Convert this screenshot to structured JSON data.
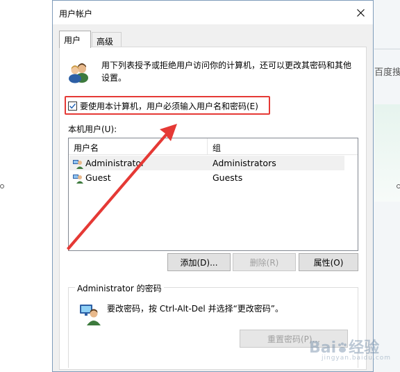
{
  "window": {
    "title": "用户帐户"
  },
  "tabs": [
    {
      "label": "用户",
      "active": true
    },
    {
      "label": "高级",
      "active": false
    }
  ],
  "intro": {
    "text": "用下列表授予或拒绝用户访问你的计算机，还可以更改其密码和其他设置。"
  },
  "require_login": {
    "label": "要使用本计算机，用户必须输入用户名和密码(E)",
    "checked": true
  },
  "local_users": {
    "label": "本机用户(U):",
    "columns": [
      "用户名",
      "组"
    ],
    "rows": [
      {
        "name": "Administrator",
        "group": "Administrators",
        "selected": true
      },
      {
        "name": "Guest",
        "group": "Guests",
        "selected": false
      }
    ]
  },
  "buttons": {
    "add": "添加(D)...",
    "remove": "删除(R)",
    "properties": "属性(O)"
  },
  "password_group": {
    "title": "Administrator 的密码",
    "text": "要改密码，按 Ctrl-Alt-Del 并选择“更改密码”。",
    "reset_button": "重置密码(P)..."
  },
  "background": {
    "side_text": "百度搜索"
  },
  "watermark": {
    "brand": "Bai",
    "brand2": "经验",
    "sub": "jingyan.baidu.com"
  },
  "colors": {
    "annotation_red": "#e53935",
    "dialog_border": "#7f9cba",
    "checkbox_check": "#1a5fb4"
  }
}
